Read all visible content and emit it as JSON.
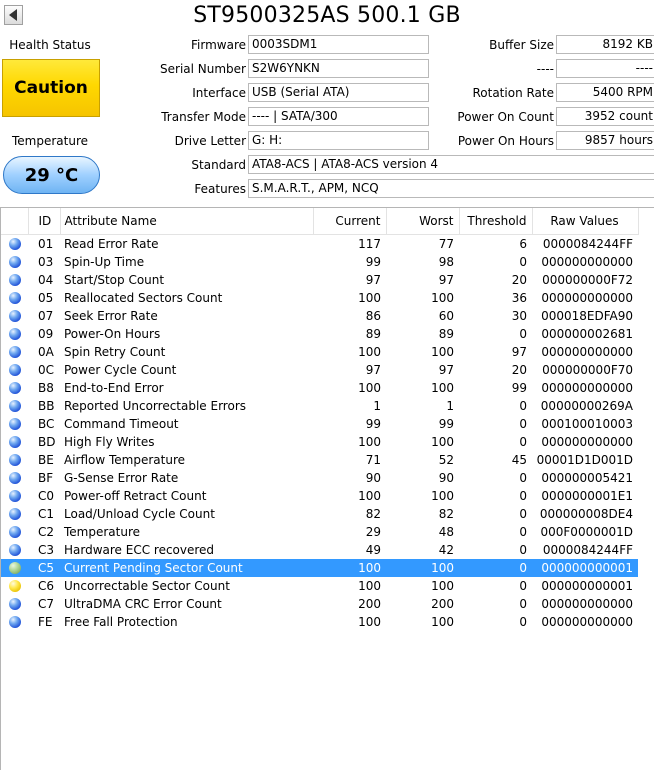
{
  "title": "ST9500325AS 500.1 GB",
  "health": {
    "label": "Health Status",
    "status": "Caution"
  },
  "temperature": {
    "label": "Temperature",
    "value": "29 °C"
  },
  "info": {
    "firmware": {
      "label": "Firmware",
      "value": "0003SDM1"
    },
    "serial": {
      "label": "Serial Number",
      "value": "S2W6YNKN"
    },
    "interface": {
      "label": "Interface",
      "value": "USB (Serial ATA)"
    },
    "transfer_mode": {
      "label": "Transfer Mode",
      "value": "---- | SATA/300"
    },
    "drive_letter": {
      "label": "Drive Letter",
      "value": "G: H:"
    },
    "standard": {
      "label": "Standard",
      "value": "ATA8-ACS | ATA8-ACS version 4"
    },
    "features": {
      "label": "Features",
      "value": "S.M.A.R.T., APM, NCQ"
    },
    "buffer_size": {
      "label": "Buffer Size",
      "value": "8192 KB"
    },
    "unknown": {
      "label": "----",
      "value": "----"
    },
    "rotation_rate": {
      "label": "Rotation Rate",
      "value": "5400 RPM"
    },
    "power_on_count": {
      "label": "Power On Count",
      "value": "3952 count"
    },
    "power_on_hours": {
      "label": "Power On Hours",
      "value": "9857 hours"
    }
  },
  "table": {
    "headers": {
      "id": "ID",
      "name": "Attribute Name",
      "current": "Current",
      "worst": "Worst",
      "threshold": "Threshold",
      "raw": "Raw Values"
    },
    "rows": [
      {
        "status": "blue",
        "id": "01",
        "name": "Read Error Rate",
        "current": "117",
        "worst": "77",
        "threshold": "6",
        "raw": "0000084244FF"
      },
      {
        "status": "blue",
        "id": "03",
        "name": "Spin-Up Time",
        "current": "99",
        "worst": "98",
        "threshold": "0",
        "raw": "000000000000"
      },
      {
        "status": "blue",
        "id": "04",
        "name": "Start/Stop Count",
        "current": "97",
        "worst": "97",
        "threshold": "20",
        "raw": "000000000F72"
      },
      {
        "status": "blue",
        "id": "05",
        "name": "Reallocated Sectors Count",
        "current": "100",
        "worst": "100",
        "threshold": "36",
        "raw": "000000000000"
      },
      {
        "status": "blue",
        "id": "07",
        "name": "Seek Error Rate",
        "current": "86",
        "worst": "60",
        "threshold": "30",
        "raw": "000018EDFA90"
      },
      {
        "status": "blue",
        "id": "09",
        "name": "Power-On Hours",
        "current": "89",
        "worst": "89",
        "threshold": "0",
        "raw": "000000002681"
      },
      {
        "status": "blue",
        "id": "0A",
        "name": "Spin Retry Count",
        "current": "100",
        "worst": "100",
        "threshold": "97",
        "raw": "000000000000"
      },
      {
        "status": "blue",
        "id": "0C",
        "name": "Power Cycle Count",
        "current": "97",
        "worst": "97",
        "threshold": "20",
        "raw": "000000000F70"
      },
      {
        "status": "blue",
        "id": "B8",
        "name": "End-to-End Error",
        "current": "100",
        "worst": "100",
        "threshold": "99",
        "raw": "000000000000"
      },
      {
        "status": "blue",
        "id": "BB",
        "name": "Reported Uncorrectable Errors",
        "current": "1",
        "worst": "1",
        "threshold": "0",
        "raw": "00000000269A"
      },
      {
        "status": "blue",
        "id": "BC",
        "name": "Command Timeout",
        "current": "99",
        "worst": "99",
        "threshold": "0",
        "raw": "000100010003"
      },
      {
        "status": "blue",
        "id": "BD",
        "name": "High Fly Writes",
        "current": "100",
        "worst": "100",
        "threshold": "0",
        "raw": "000000000000"
      },
      {
        "status": "blue",
        "id": "BE",
        "name": "Airflow Temperature",
        "current": "71",
        "worst": "52",
        "threshold": "45",
        "raw": "00001D1D001D"
      },
      {
        "status": "blue",
        "id": "BF",
        "name": "G-Sense Error Rate",
        "current": "90",
        "worst": "90",
        "threshold": "0",
        "raw": "000000005421"
      },
      {
        "status": "blue",
        "id": "C0",
        "name": "Power-off Retract Count",
        "current": "100",
        "worst": "100",
        "threshold": "0",
        "raw": "0000000001E1"
      },
      {
        "status": "blue",
        "id": "C1",
        "name": "Load/Unload Cycle Count",
        "current": "82",
        "worst": "82",
        "threshold": "0",
        "raw": "000000008DE4"
      },
      {
        "status": "blue",
        "id": "C2",
        "name": "Temperature",
        "current": "29",
        "worst": "48",
        "threshold": "0",
        "raw": "000F0000001D"
      },
      {
        "status": "blue",
        "id": "C3",
        "name": "Hardware ECC recovered",
        "current": "49",
        "worst": "42",
        "threshold": "0",
        "raw": "0000084244FF"
      },
      {
        "status": "green",
        "id": "C5",
        "name": "Current Pending Sector Count",
        "current": "100",
        "worst": "100",
        "threshold": "0",
        "raw": "000000000001",
        "selected": true
      },
      {
        "status": "yellow",
        "id": "C6",
        "name": "Uncorrectable Sector Count",
        "current": "100",
        "worst": "100",
        "threshold": "0",
        "raw": "000000000001"
      },
      {
        "status": "blue",
        "id": "C7",
        "name": "UltraDMA CRC Error Count",
        "current": "200",
        "worst": "200",
        "threshold": "0",
        "raw": "000000000000"
      },
      {
        "status": "blue",
        "id": "FE",
        "name": "Free Fall Protection",
        "current": "100",
        "worst": "100",
        "threshold": "0",
        "raw": "000000000000"
      }
    ]
  }
}
